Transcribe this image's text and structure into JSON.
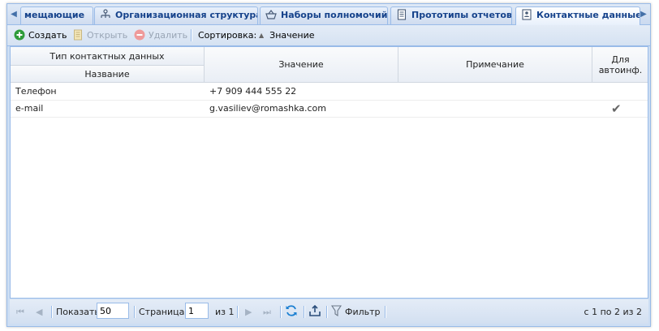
{
  "tabs": [
    {
      "label": "мещающие",
      "icon": "truncated"
    },
    {
      "label": "Организационная структура",
      "icon": "org-structure-icon"
    },
    {
      "label": "Наборы полномочий",
      "icon": "basket-icon"
    },
    {
      "label": "Прототипы отчетов",
      "icon": "report-icon"
    },
    {
      "label": "Контактные данные",
      "icon": "contact-card-icon",
      "active": true
    }
  ],
  "toolbar": {
    "create_label": "Создать",
    "open_label": "Открыть",
    "delete_label": "Удалить",
    "sort_label": "Сортировка:",
    "sort_field": "Значение"
  },
  "grid": {
    "group_header": "Тип контактных данных",
    "columns": {
      "name": "Название",
      "value": "Значение",
      "note": "Примечание",
      "autoinf": "Для автоинф."
    },
    "rows": [
      {
        "name": "Телефон",
        "value": "+7 909 444 555 22",
        "note": "",
        "autoinf": ""
      },
      {
        "name": "e-mail",
        "value": "g.vasiliev@romashka.com",
        "note": "",
        "autoinf": "✔"
      }
    ]
  },
  "pager": {
    "show_label": "Показать",
    "page_size": "50",
    "page_label": "Страница",
    "page": "1",
    "of_label": "из 1",
    "filter_label": "Фильтр",
    "summary": "с 1 по 2 из 2"
  }
}
